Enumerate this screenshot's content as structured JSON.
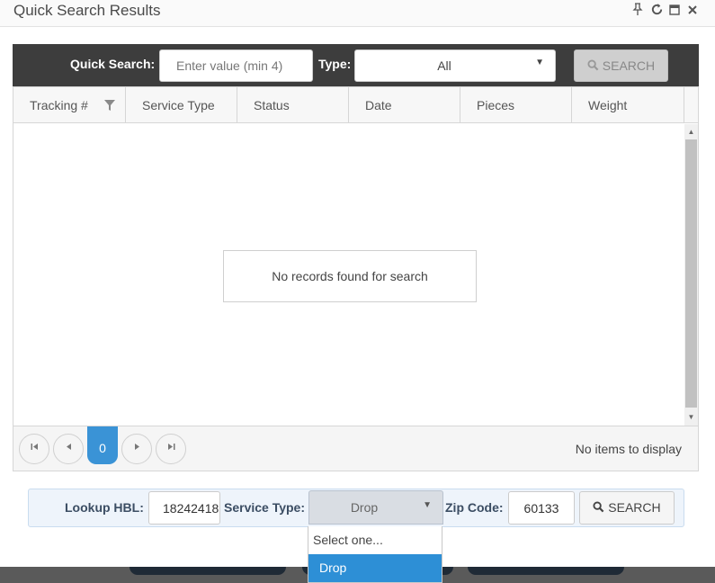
{
  "window": {
    "title": "Quick Search Results",
    "icons": [
      "pin-icon",
      "refresh-icon",
      "maximize-icon",
      "close-icon"
    ]
  },
  "quick_search": {
    "label": "Quick Search:",
    "placeholder": "Enter value (min 4)",
    "type_label": "Type:",
    "type_value": "All",
    "search_label": "SEARCH"
  },
  "grid": {
    "columns": [
      "Tracking #",
      "Service Type",
      "Status",
      "Date",
      "Pieces",
      "Weight"
    ],
    "empty_message": "No records found for search"
  },
  "pager": {
    "current_page": "0",
    "info": "No items to display"
  },
  "lookup": {
    "hbl_label": "Lookup HBL:",
    "hbl_value": "18242418",
    "service_label": "Service Type:",
    "service_value": "Drop",
    "zip_label": "Zip Code:",
    "zip_value": "60133",
    "search_label": "SEARCH"
  },
  "service_dropdown": {
    "options": [
      "Select one...",
      "Drop"
    ],
    "highlighted": "Drop"
  },
  "colors": {
    "toolbar_bg": "#3d3d3d",
    "accent": "#3a93d6",
    "lookup_bg": "#eef4fb"
  }
}
